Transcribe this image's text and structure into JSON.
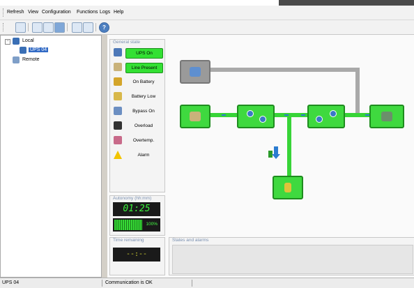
{
  "menu": [
    "Refresh",
    "View",
    "Configuration",
    "Functions",
    "Logs",
    "Help"
  ],
  "tree": {
    "local": "Local",
    "ups": "UPS 04",
    "remote": "Remote"
  },
  "general_state": {
    "title": "General state",
    "items": [
      {
        "label": "UPS On",
        "active": true,
        "icon": "ups-icon"
      },
      {
        "label": "Line Present",
        "active": true,
        "icon": "plug-icon"
      },
      {
        "label": "On Battery",
        "active": false,
        "icon": "battery-icon"
      },
      {
        "label": "Battery Low",
        "active": false,
        "icon": "battery-low-icon"
      },
      {
        "label": "Bypass On",
        "active": false,
        "icon": "bypass-icon"
      },
      {
        "label": "Overload",
        "active": false,
        "icon": "weight-icon"
      },
      {
        "label": "Overtemp.",
        "active": false,
        "icon": "thermometer-icon"
      },
      {
        "label": "Alarm",
        "active": false,
        "icon": "warning-icon"
      }
    ]
  },
  "autonomy": {
    "title": "Autonomy (hh:mm)",
    "value": "01:25",
    "charge_percent": 100,
    "charge_label": "100%"
  },
  "time_remaining": {
    "title": "Time remaining",
    "value": "--:--"
  },
  "states_alarms": {
    "title": "States and alarms"
  },
  "status_bar": {
    "device": "UPS 04",
    "communication": "Communication is OK"
  },
  "colors": {
    "active_green": "#33e033",
    "node_green": "#3fd93f",
    "pipe_grey": "#a9a9a9",
    "lcd_green": "#3cf03c"
  }
}
